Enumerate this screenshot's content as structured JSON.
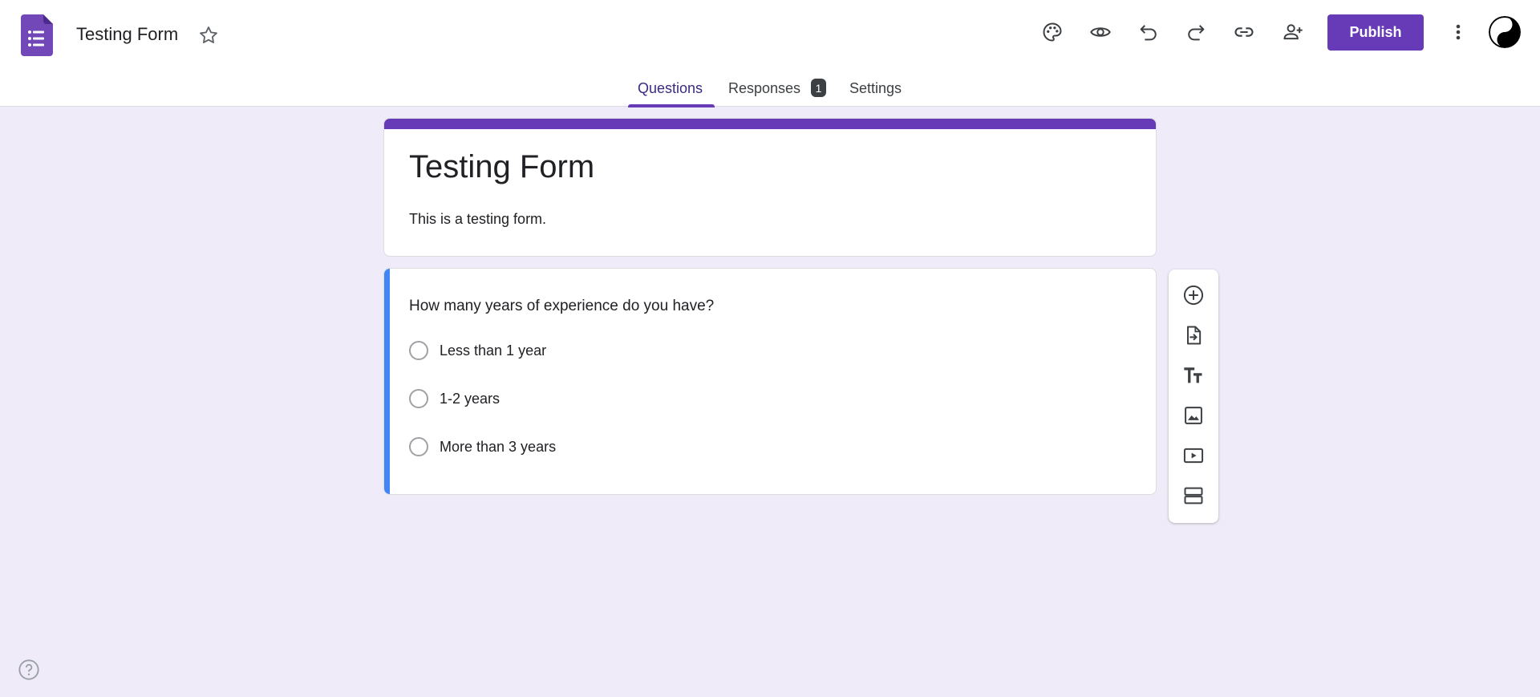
{
  "header": {
    "doc_title": "Testing Form",
    "publish_label": "Publish",
    "icons": [
      "forms-logo-icon",
      "star-icon",
      "palette-icon",
      "preview-eye-icon",
      "undo-icon",
      "redo-icon",
      "link-icon",
      "add-collaborator-icon",
      "more-vert-icon",
      "avatar"
    ]
  },
  "tabs": [
    {
      "label": "Questions",
      "active": true
    },
    {
      "label": "Responses",
      "badge": "1"
    },
    {
      "label": "Settings"
    }
  ],
  "form": {
    "title": "Testing Form",
    "description": "This is a testing form."
  },
  "question": {
    "text": "How many years of experience do you have?",
    "options": [
      "Less than 1 year",
      "1-2 years",
      "More than 3 years"
    ]
  },
  "side_toolbar": [
    "add-question-icon",
    "import-questions-icon",
    "add-title-icon",
    "add-image-icon",
    "add-video-icon",
    "add-section-icon"
  ],
  "colors": {
    "accent": "#673ab7",
    "background": "#efebf8",
    "question_highlight": "#4285f4"
  }
}
